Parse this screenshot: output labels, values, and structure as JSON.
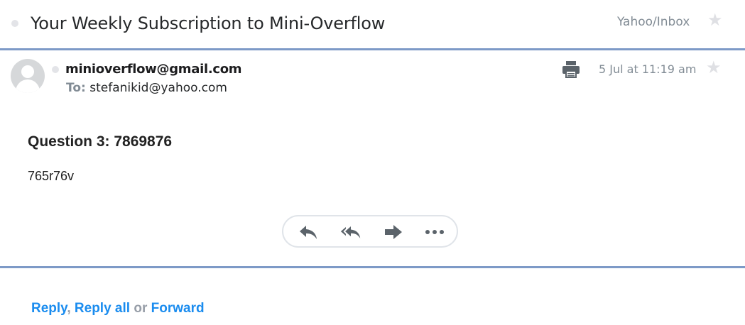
{
  "header": {
    "subject": "Your Weekly Subscription to Mini-Overflow",
    "folder": "Yahoo/Inbox",
    "star_icon": "star-icon"
  },
  "message": {
    "sender": "minioverflow@gmail.com",
    "to_label": "To:",
    "to_address": "stefanikid@yahoo.com",
    "date": "5 Jul at 11:19 am",
    "icons": [
      "avatar-icon",
      "print-icon",
      "star-icon"
    ]
  },
  "body": {
    "heading": "Question 3: 7869876",
    "text": "765r76v"
  },
  "actions": {
    "icons": [
      "reply-icon",
      "reply-all-icon",
      "forward-icon",
      "more-icon"
    ]
  },
  "footer": {
    "reply": "Reply",
    "comma": ",",
    "reply_all": "Reply all",
    "or": "or",
    "forward": "Forward"
  },
  "colors": {
    "accent_rule": "#7d9ac7",
    "link": "#1a8cef",
    "muted_text": "#828c95",
    "icon_dark": "#5b636a"
  }
}
